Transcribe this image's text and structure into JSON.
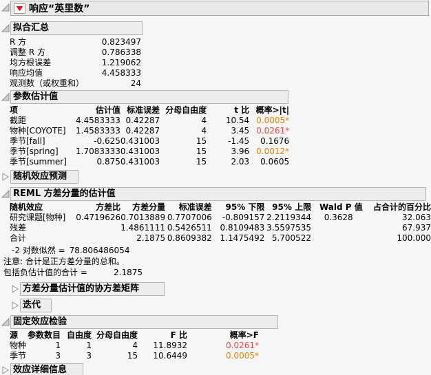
{
  "title": {
    "label": "响应“英里数”"
  },
  "colors": {
    "p-orange": "#e8820a",
    "p-red": "#fb4b42",
    "accent-red": "#d11717"
  },
  "fit_summary": {
    "header": "拟合汇总",
    "rows": [
      {
        "label": "R 方",
        "value": "0.823497"
      },
      {
        "label": "调整 R 方",
        "value": "0.786338"
      },
      {
        "label": "均方根误差",
        "value": "1.219062"
      },
      {
        "label": "响应均值",
        "value": "4.458333"
      },
      {
        "label": "观测数（或权重和）",
        "value": "24"
      }
    ]
  },
  "parameter_estimates": {
    "header": "参数估计值",
    "columns": [
      "项",
      "估计值",
      "标准误差",
      "分母自由度",
      "t 比",
      "概率>|t|"
    ],
    "rows": [
      {
        "term": "截距",
        "estimate": "4.4583333",
        "std_error": "0.42287",
        "df_den": "4",
        "t_ratio": "10.54",
        "prob": "0.0005*",
        "prob_color": "orange"
      },
      {
        "term": "物种[COYOTE]",
        "estimate": "1.4583333",
        "std_error": "0.42287",
        "df_den": "4",
        "t_ratio": "3.45",
        "prob": "0.0261*",
        "prob_color": "red"
      },
      {
        "term": "季节[fall]",
        "estimate": "-0.625",
        "std_error": "0.431003",
        "df_den": "15",
        "t_ratio": "-1.45",
        "prob": "0.1676",
        "prob_color": "black"
      },
      {
        "term": "季节[spring]",
        "estimate": "1.7083333",
        "std_error": "0.431003",
        "df_den": "15",
        "t_ratio": "3.96",
        "prob": "0.0012*",
        "prob_color": "orange"
      },
      {
        "term": "季节[summer]",
        "estimate": "0.875",
        "std_error": "0.431003",
        "df_den": "15",
        "t_ratio": "2.03",
        "prob": "0.0605",
        "prob_color": "black"
      }
    ]
  },
  "random_effect_predictions": {
    "header": "随机效应预测"
  },
  "reml": {
    "header": "REML 方差分量的估计值",
    "columns": [
      "随机效应",
      "方差比",
      "方差分量",
      "标准误差",
      "95% 下限",
      "95% 上限",
      "Wald P 值",
      "占合计的百分比"
    ],
    "rows": [
      {
        "effect": "研究课题[物种]",
        "var_ratio": "0.4719626",
        "var_component": "0.7013889",
        "std_error": "0.7707006",
        "lower": "-0.809157",
        "upper": "2.2119344",
        "wald_p": "0.3628",
        "pct": "32.063"
      },
      {
        "effect": "残差",
        "var_ratio": "",
        "var_component": "1.4861111",
        "std_error": "0.5426511",
        "lower": "0.8109483",
        "upper": "3.5597535",
        "wald_p": "",
        "pct": "67.937"
      },
      {
        "effect": "合计",
        "var_ratio": "",
        "var_component": "2.1875",
        "std_error": "0.8609382",
        "lower": "1.1475492",
        "upper": "5.700522",
        "wald_p": "",
        "pct": "100.000"
      }
    ],
    "neg2ll_label": "-2 对数似然 =",
    "neg2ll_value": "78.806486054",
    "note": "注意: 合计是正方差分量的总和。",
    "total_including_label": "包括负估计值的合计 =",
    "total_including_value": "2.1875",
    "cov_matrix_header": "方差分量估计值的协方差矩阵",
    "iterations_header": "迭代"
  },
  "fixed_effect_tests": {
    "header": "固定效应检验",
    "columns": [
      "源",
      "参数数目",
      "自由度",
      "分母自由度",
      "F 比",
      "概率>F"
    ],
    "rows": [
      {
        "source": "物种",
        "nparm": "1",
        "df": "1",
        "df_den": "4",
        "f_ratio": "11.8932",
        "prob": "0.0261*",
        "prob_color": "red"
      },
      {
        "source": "季节",
        "nparm": "3",
        "df": "3",
        "df_den": "15",
        "f_ratio": "10.6449",
        "prob": "0.0005*",
        "prob_color": "orange"
      }
    ]
  },
  "effect_details": {
    "header": "效应详细信息"
  }
}
